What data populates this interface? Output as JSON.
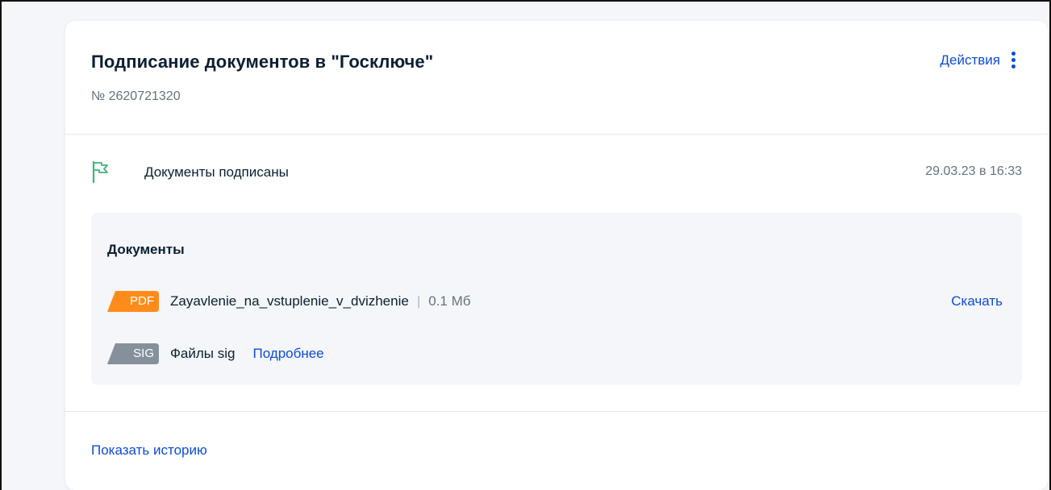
{
  "header": {
    "title": "Подписание документов в \"Госключе\"",
    "number": "№ 2620721320",
    "actions_label": "Действия"
  },
  "status": {
    "text": "Документы подписаны",
    "date": "29.03.23 в 16:33",
    "icon": "flag-icon",
    "icon_color": "#3fb37b"
  },
  "documents": {
    "title": "Документы",
    "files": [
      {
        "badge": "PDF",
        "badge_color": "#ff8c1a",
        "name": "Zayavlenie_na_vstuplenie_v_dvizhenie",
        "separator": "|",
        "size": "0.1 Мб",
        "action": "Скачать"
      },
      {
        "badge": "SIG",
        "badge_color": "#86909c",
        "name": "Файлы sig",
        "action": "Подробнее"
      }
    ]
  },
  "footer": {
    "history_link": "Показать историю"
  },
  "colors": {
    "accent": "#0d4cd3",
    "text": "#0b1f33",
    "muted": "#66727f",
    "panel": "#f4f6f9"
  }
}
